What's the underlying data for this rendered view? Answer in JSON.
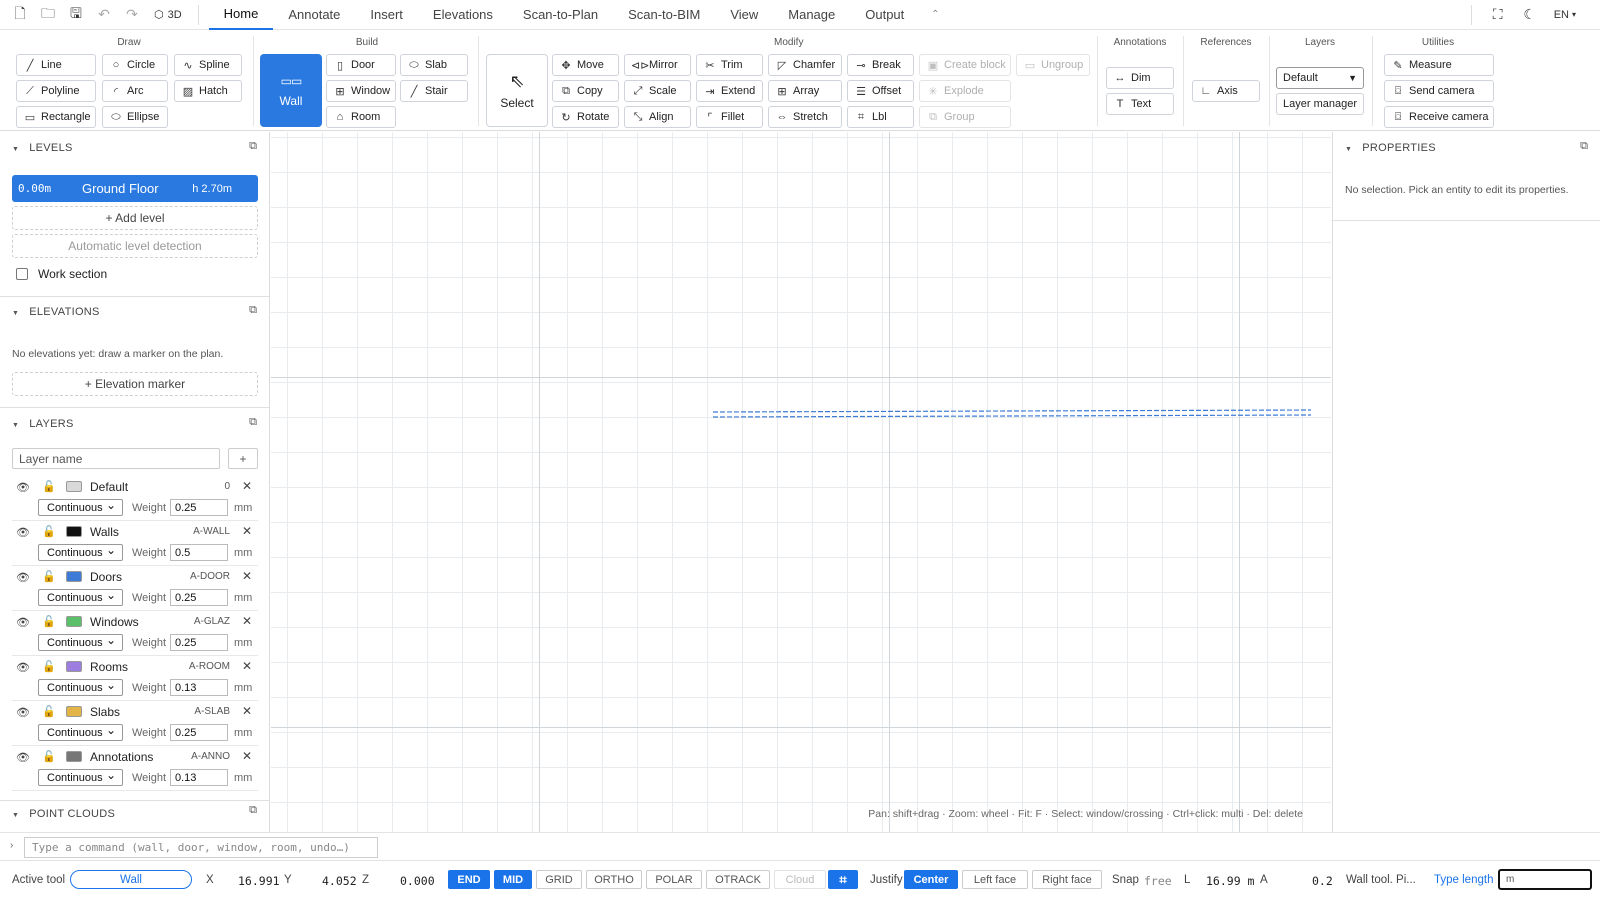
{
  "toolbar": {
    "view3d_label": "3D",
    "tabs": [
      "Home",
      "Annotate",
      "Insert",
      "Elevations",
      "Scan-to-Plan",
      "Scan-to-BIM",
      "View",
      "Manage",
      "Output"
    ],
    "language": "EN"
  },
  "ribbon": {
    "draw": {
      "title": "Draw",
      "items": [
        "Line",
        "Circle",
        "Spline",
        "Polyline",
        "Arc",
        "Hatch",
        "Rectangle",
        "Ellipse"
      ]
    },
    "build": {
      "title": "Build",
      "wall": "Wall",
      "items": [
        "Door",
        "Slab",
        "Window",
        "Stair",
        "Room"
      ]
    },
    "select": "Select",
    "modify": {
      "title": "Modify",
      "items": [
        "Move",
        "Mirror",
        "Trim",
        "Chamfer",
        "Break",
        "Create block",
        "Ungroup",
        "Copy",
        "Scale",
        "Extend",
        "Array",
        "Offset",
        "Explode",
        "Rotate",
        "Align",
        "Fillet",
        "Stretch",
        "Lbl",
        "Group"
      ]
    },
    "annotations": {
      "title": "Annotations",
      "items": [
        "Dim",
        "Text"
      ]
    },
    "references": {
      "title": "References",
      "items": [
        "Axis"
      ]
    },
    "layers": {
      "title": "Layers",
      "selected": "Default",
      "manager": "Layer manager"
    },
    "utilities": {
      "title": "Utilities",
      "items": [
        "Measure",
        "Send camera",
        "Receive camera"
      ]
    }
  },
  "left": {
    "levels_title": "LEVELS",
    "level": {
      "elev": "0.00m",
      "name": "Ground Floor",
      "height": "h 2.70m"
    },
    "add_level": "+ Add level",
    "auto_level": "Automatic level detection",
    "work_section": "Work section",
    "elevations_title": "ELEVATIONS",
    "elevations_empty": "No elevations yet: draw a marker on the plan.",
    "elevation_marker": "+ Elevation marker",
    "layers_title": "LAYERS",
    "layer_placeholder": "Layer name",
    "add_layer": "+",
    "weight_label": "Weight",
    "mm": "mm",
    "line_type": "Continuous",
    "layers": [
      {
        "name": "Default",
        "code": "0",
        "weight": "0.25",
        "color": "#d9d9d9"
      },
      {
        "name": "Walls",
        "code": "A-WALL",
        "weight": "0.5",
        "color": "#111111"
      },
      {
        "name": "Doors",
        "code": "A-DOOR",
        "weight": "0.25",
        "color": "#3d7bd6"
      },
      {
        "name": "Windows",
        "code": "A-GLAZ",
        "weight": "0.25",
        "color": "#5cbf6a"
      },
      {
        "name": "Rooms",
        "code": "A-ROOM",
        "weight": "0.13",
        "color": "#9d7de0"
      },
      {
        "name": "Slabs",
        "code": "A-SLAB",
        "weight": "0.25",
        "color": "#e3b448"
      },
      {
        "name": "Annotations",
        "code": "A-ANNO",
        "weight": "0.13",
        "color": "#777777"
      }
    ],
    "point_clouds_title": "POINT CLOUDS"
  },
  "canvas": {
    "hint": "Pan: shift+drag · Zoom: wheel · Fit: F · Select: window/crossing · Ctrl+click: multi · Del: delete"
  },
  "properties": {
    "title": "PROPERTIES",
    "empty": "No selection. Pick an entity to edit its properties."
  },
  "command": {
    "placeholder": "Type a command (wall, door, window, room, undo…)"
  },
  "status": {
    "active_tool_label": "Active tool",
    "active_tool": "Wall",
    "x_label": "X",
    "x": "16.991",
    "y_label": "Y",
    "y": "4.052",
    "z_label": "Z",
    "z": "0.000",
    "toggles": [
      "END",
      "MID",
      "GRID",
      "ORTHO",
      "POLAR",
      "OTRACK",
      "Cloud"
    ],
    "justify_label": "Justify",
    "justify": [
      "Center",
      "Left face",
      "Right face"
    ],
    "snap_label": "Snap",
    "snap": "free",
    "l_label": "L",
    "l": "16.99 m",
    "a_label": "A",
    "a": "0.2",
    "message": "Wall tool. Pi...",
    "type_length_label": "Type length",
    "type_length": "m"
  }
}
